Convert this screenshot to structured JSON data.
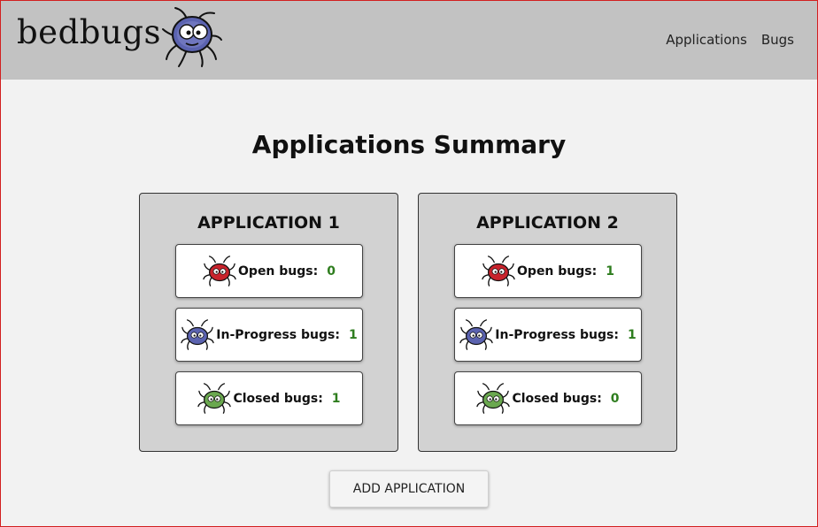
{
  "header": {
    "logo_text": "bedbugs",
    "logo_icon": "bug-mascot-icon",
    "nav": [
      {
        "label": "Applications"
      },
      {
        "label": "Bugs"
      }
    ]
  },
  "main": {
    "title": "Applications Summary",
    "applications": [
      {
        "name": "APPLICATION 1",
        "stats": [
          {
            "label": "Open bugs:",
            "count": "0",
            "icon": "red-bug-icon"
          },
          {
            "label": "In-Progress bugs:",
            "count": "1",
            "icon": "blue-bug-icon"
          },
          {
            "label": "Closed bugs:",
            "count": "1",
            "icon": "green-bug-icon"
          }
        ]
      },
      {
        "name": "APPLICATION 2",
        "stats": [
          {
            "label": "Open bugs:",
            "count": "1",
            "icon": "red-bug-icon"
          },
          {
            "label": "In-Progress bugs:",
            "count": "1",
            "icon": "blue-bug-icon"
          },
          {
            "label": "Closed bugs:",
            "count": "0",
            "icon": "green-bug-icon"
          }
        ]
      }
    ],
    "add_button_label": "ADD APPLICATION"
  },
  "colors": {
    "header_bg": "#c2c2c2",
    "page_bg": "#f2f2f2",
    "card_bg": "#d2d2d2",
    "count_green": "#2e7d1e",
    "open_bug": "#c8232c",
    "in_progress_bug": "#5b63b0",
    "closed_bug": "#6aa84f"
  }
}
